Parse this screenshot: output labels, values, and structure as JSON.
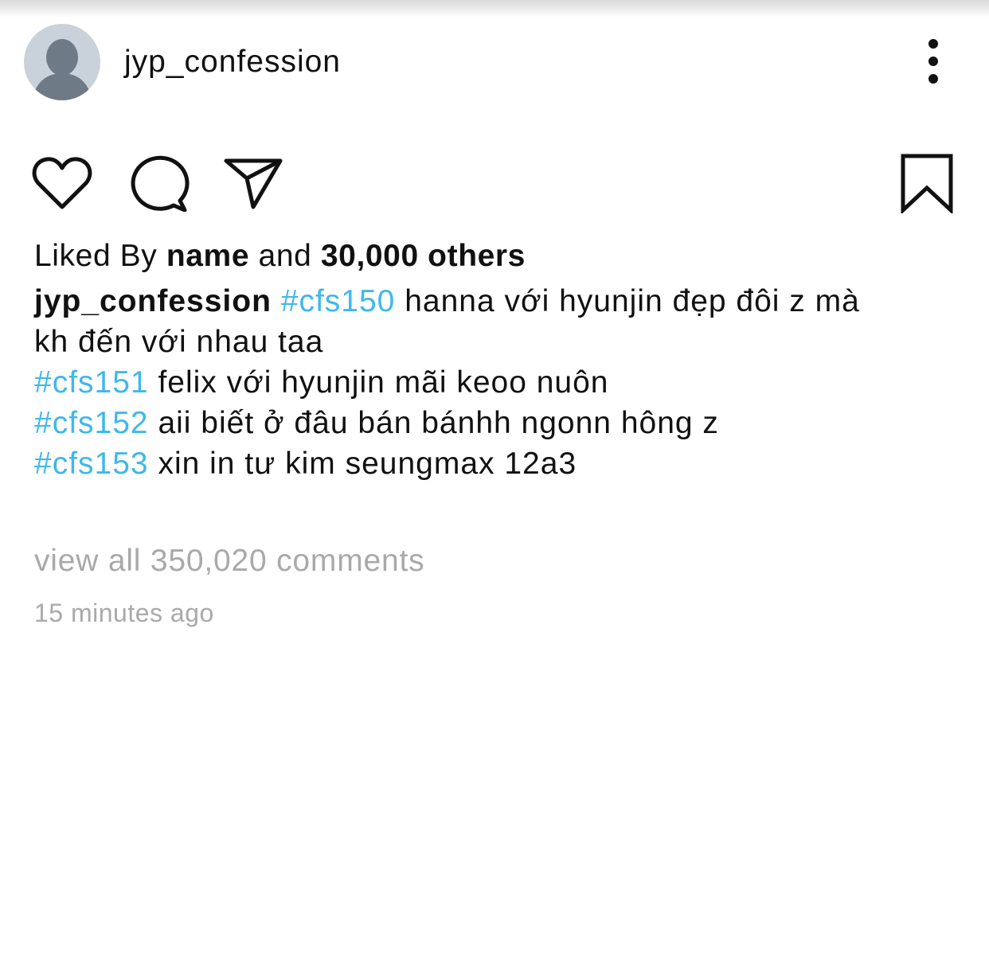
{
  "post": {
    "username": "jyp_confession",
    "avatar_icon": "default-user-avatar-icon",
    "more_icon": "vertical-ellipsis-icon"
  },
  "actions": {
    "like_icon": "heart-outline-icon",
    "comment_icon": "comment-bubble-icon",
    "share_icon": "paper-plane-icon",
    "save_icon": "bookmark-outline-icon"
  },
  "likes": {
    "prefix": "Liked By",
    "name": "name",
    "connector": "and",
    "others": "30,000 others"
  },
  "caption": {
    "username": "jyp_confession",
    "entries": [
      {
        "tag": "#cfs150",
        "text_line1": "hanna với hyunjin đẹp đôi z mà",
        "text_line2": "kh đến với nhau taa"
      },
      {
        "tag": "#cfs151",
        "text": "felix với hyunjin mãi keoo nuôn"
      },
      {
        "tag": "#cfs152",
        "text": "aii biết ở đâu bán bánhh ngonn hông z"
      },
      {
        "tag": "#cfs153",
        "text": "xin in tư kim seungmax 12a3"
      }
    ]
  },
  "comments": {
    "view_all": "view all 350,020 comments"
  },
  "timestamp": "15 minutes ago",
  "colors": {
    "hashtag": "#3fb8ea",
    "muted_text": "#a9a9a9",
    "avatar_bg": "#c9d1da",
    "avatar_figure": "#6e7a86",
    "text": "#111111"
  }
}
